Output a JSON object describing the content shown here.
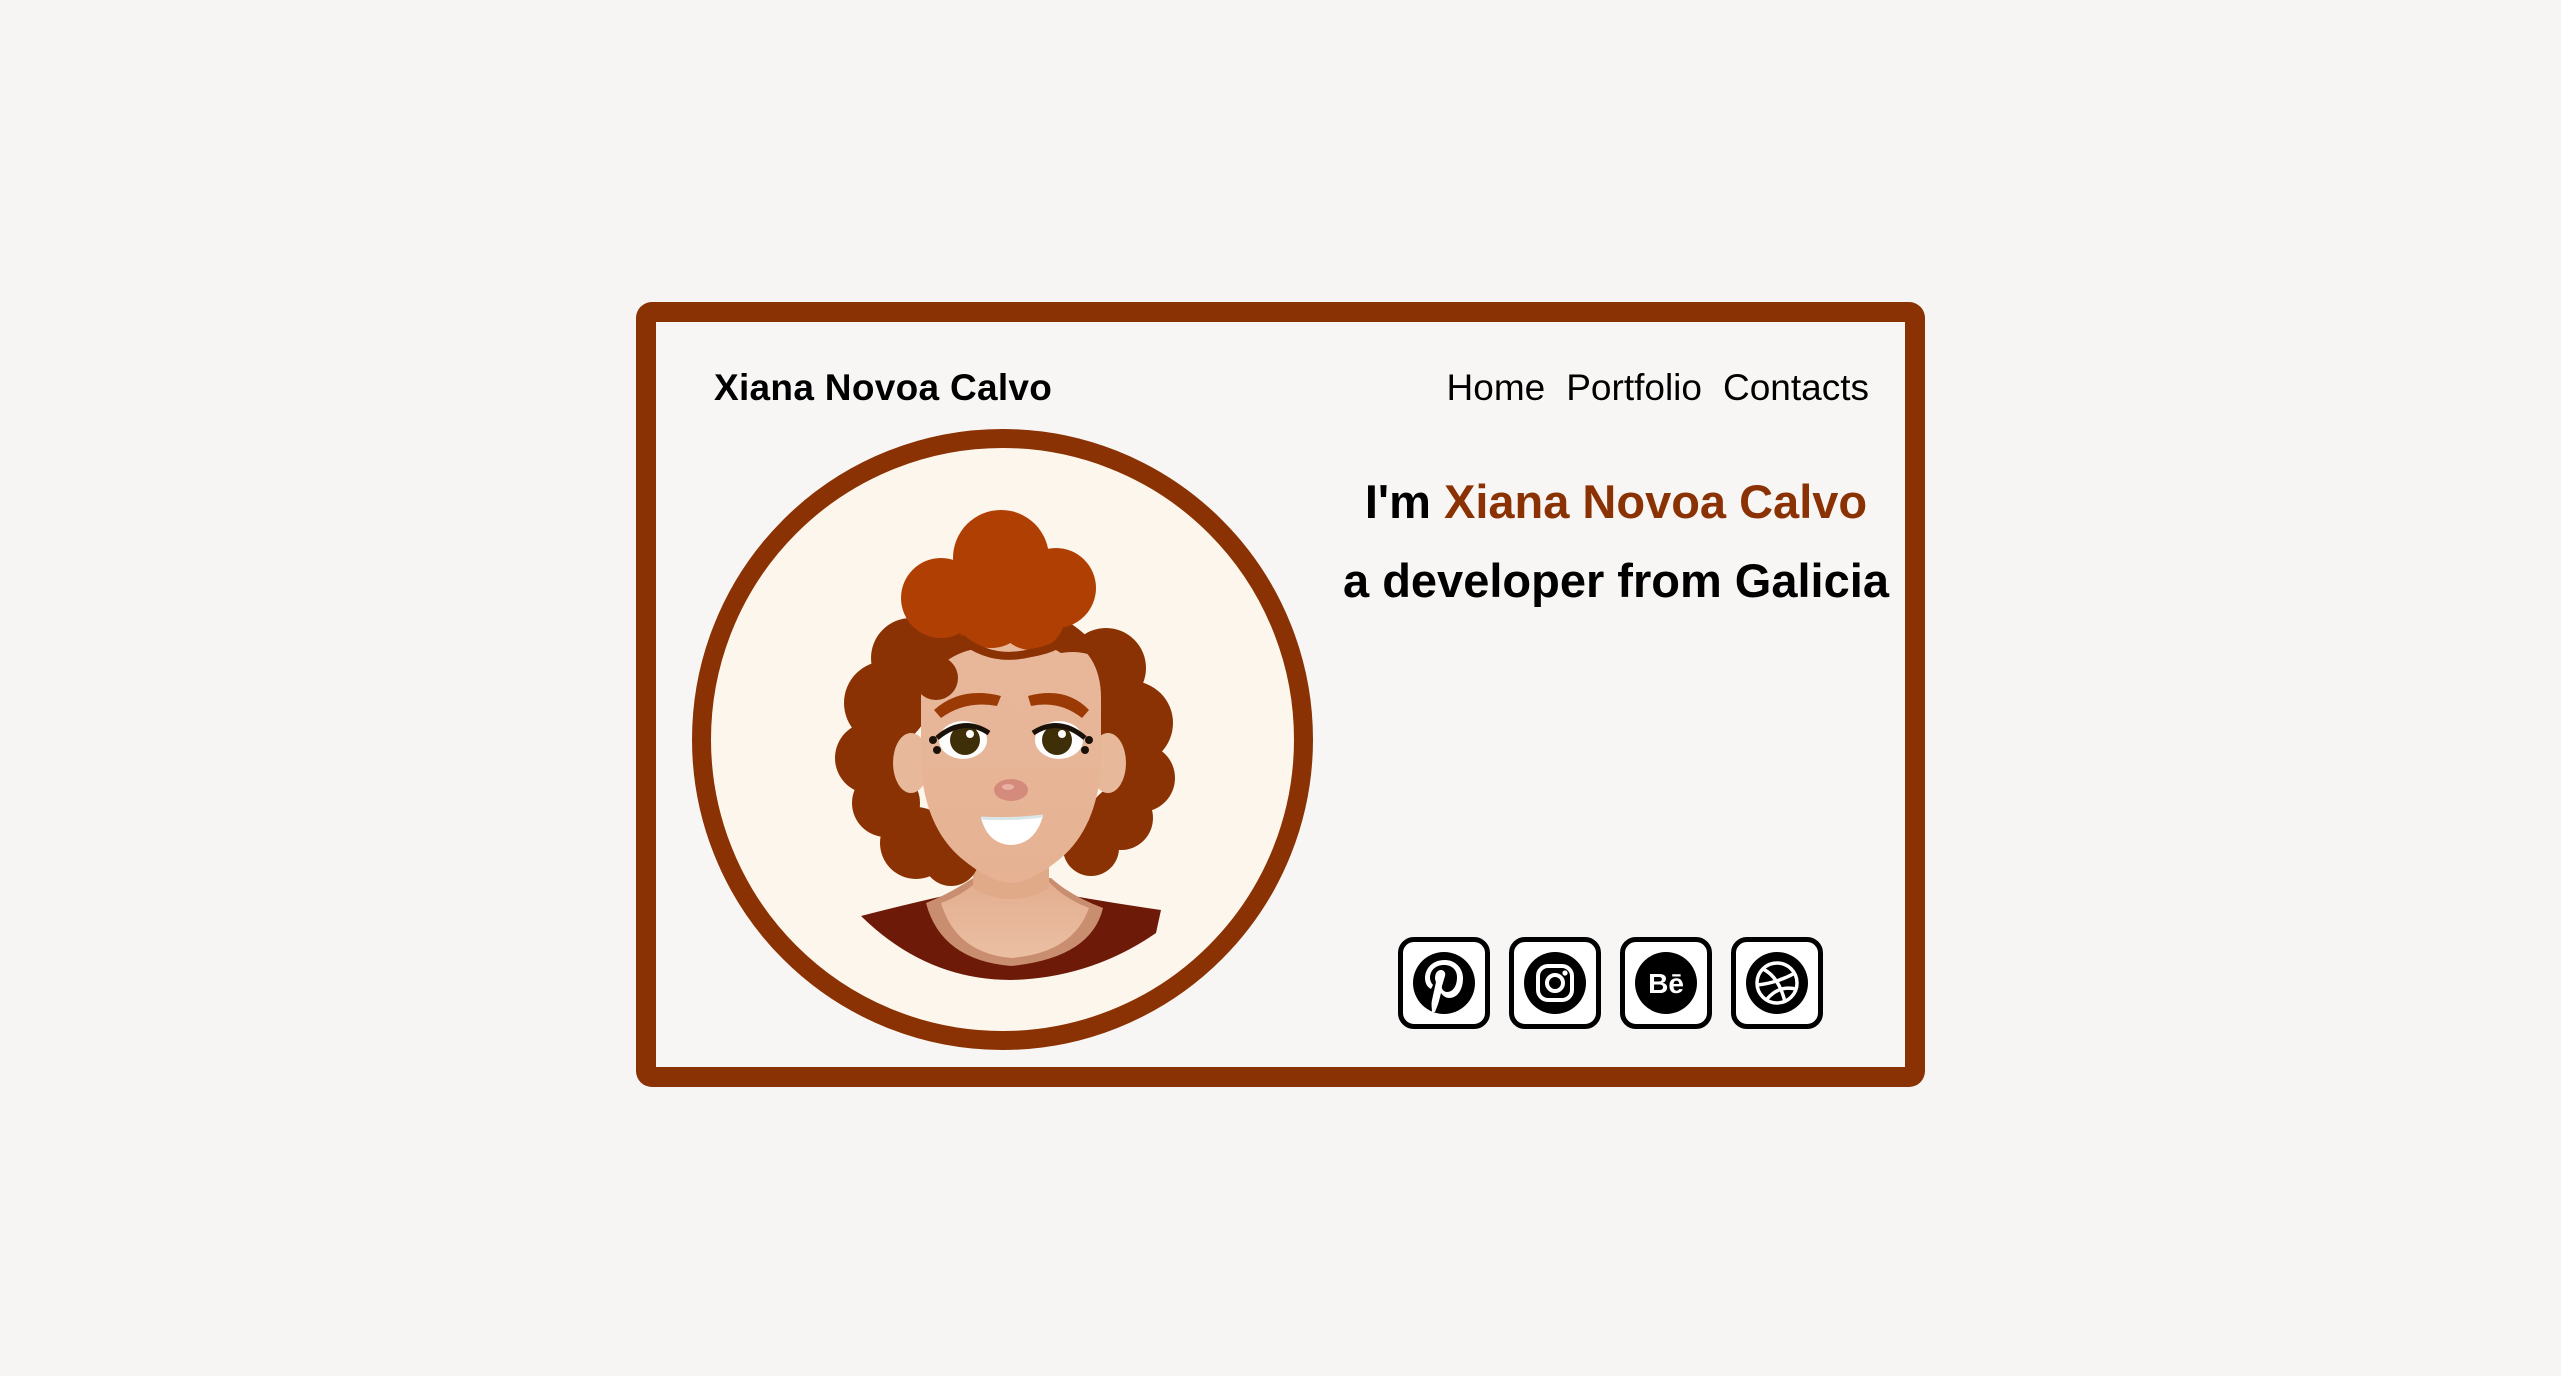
{
  "header": {
    "brand": "Xiana Novoa Calvo",
    "nav": [
      "Home",
      "Portfolio",
      "Contacts"
    ]
  },
  "hero": {
    "prefix": "I'm",
    "name": "Xiana Novoa Calvo",
    "tagline": "a developer from Galicia"
  },
  "socials": [
    {
      "icon": "pinterest-icon"
    },
    {
      "icon": "instagram-icon"
    },
    {
      "icon": "behance-icon",
      "label": "Bē"
    },
    {
      "icon": "dribbble-icon"
    }
  ],
  "colors": {
    "accent": "#8a3203",
    "background": "#f6f5f4",
    "avatar_bg": "#fdf6ec"
  }
}
